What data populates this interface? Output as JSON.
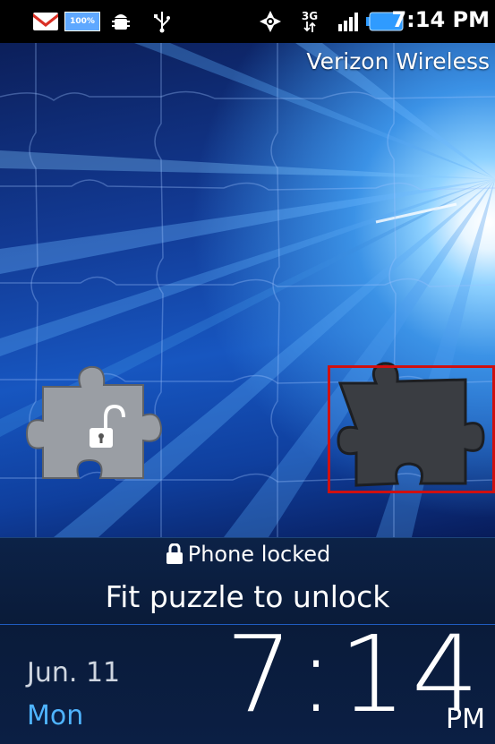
{
  "status_bar": {
    "time": "7:14 PM",
    "battery_badge": "100%",
    "network": "3G",
    "icons": [
      "gmail-icon",
      "battery-full-icon",
      "android-debug-icon",
      "usb-icon",
      "gps-icon",
      "network-3g-icon",
      "signal-icon",
      "battery-icon"
    ]
  },
  "carrier": "Verizon Wireless",
  "lock_panel": {
    "status": "Phone locked",
    "instruction": "Fit puzzle to unlock"
  },
  "clock": {
    "date": "Jun. 11",
    "day": "Mon",
    "time": "7:14",
    "ampm": "PM"
  },
  "colors": {
    "accent_blue": "#4fb4ff",
    "highlight_red": "#d01010"
  }
}
